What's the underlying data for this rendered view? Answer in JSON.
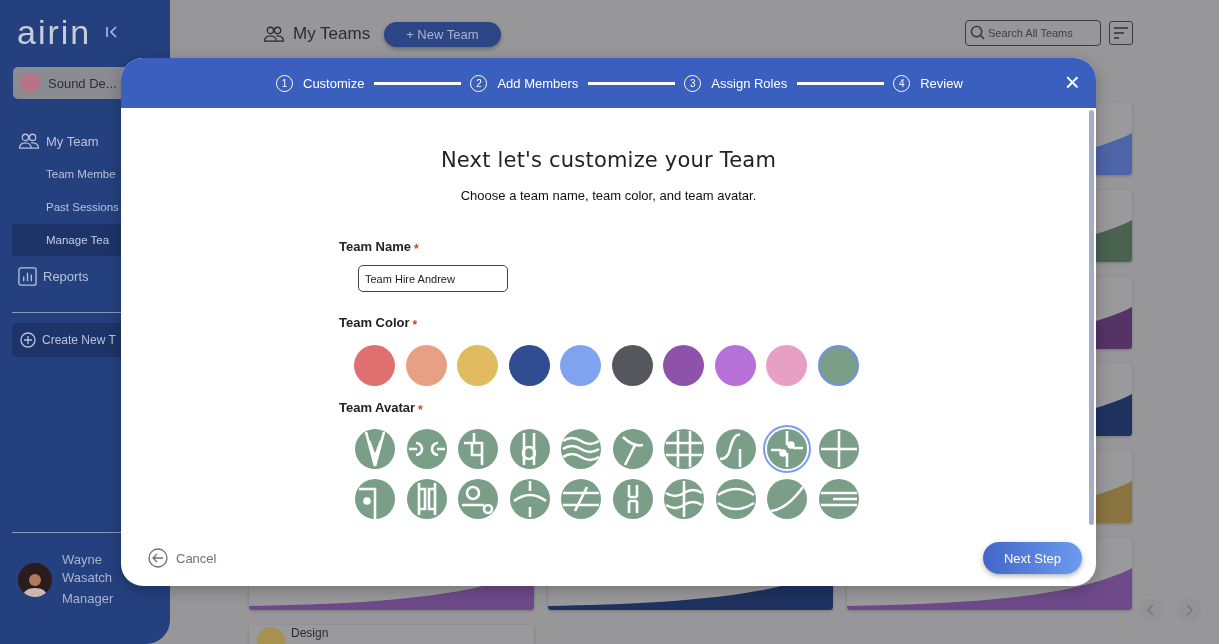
{
  "sidebar": {
    "logo": "airin",
    "team_switcher": "Sound De...",
    "nav": [
      {
        "label": "My Team",
        "kind": "section",
        "selected": false
      },
      {
        "label": "Team Membe",
        "kind": "sub",
        "selected": false
      },
      {
        "label": "Past Sessions",
        "kind": "sub",
        "selected": false
      },
      {
        "label": "Manage Tea",
        "kind": "sub",
        "selected": true
      },
      {
        "label": "Reports",
        "kind": "report",
        "selected": false
      }
    ],
    "create_button": "Create New T",
    "user": {
      "first_name": "Wayne",
      "last_name": "Wasatch",
      "role": "Manager"
    }
  },
  "header": {
    "title": "My Teams",
    "new_team_button": "+ New Team",
    "search": {
      "placeholder": "Search All Teams"
    }
  },
  "team_cards": [
    {
      "color": "#4d64a8"
    },
    {
      "color": "#4a6350"
    },
    {
      "color": "#553366"
    },
    {
      "color": "#1f3260"
    },
    {
      "color": "#8a7440"
    },
    {
      "color": "#6e4a8a"
    }
  ],
  "bottom_cards": [
    {
      "color": "#6e4a8a"
    },
    {
      "color": "#1f3260"
    }
  ],
  "design_card": {
    "name": "Design"
  },
  "modal": {
    "steps": [
      {
        "number": "1",
        "label": "Customize"
      },
      {
        "number": "2",
        "label": "Add Members"
      },
      {
        "number": "3",
        "label": "Assign Roles"
      },
      {
        "number": "4",
        "label": "Review"
      }
    ],
    "close": "×",
    "title": "Next let's customize your Team",
    "subtitle": "Choose a team name, team color, and team avatar.",
    "team_name": {
      "label": "Team Name",
      "required_mark": "*",
      "value": "Team Hire Andrew"
    },
    "team_color": {
      "label": "Team Color",
      "required_mark": "*",
      "options": [
        {
          "color": "#e07070",
          "selected": false
        },
        {
          "color": "#e8a084",
          "selected": false
        },
        {
          "color": "#e0bb60",
          "selected": false
        },
        {
          "color": "#2f4d90",
          "selected": false
        },
        {
          "color": "#7fa3ef",
          "selected": false
        },
        {
          "color": "#55575c",
          "selected": false
        },
        {
          "color": "#8f52aa",
          "selected": false
        },
        {
          "color": "#b870d9",
          "selected": false
        },
        {
          "color": "#e7a0c4",
          "selected": false
        },
        {
          "color": "#7a9e88",
          "selected": true
        }
      ]
    },
    "team_avatar": {
      "label": "Team Avatar",
      "required_mark": "*",
      "options": [
        {
          "selected": false
        },
        {
          "selected": false
        },
        {
          "selected": false
        },
        {
          "selected": false
        },
        {
          "selected": false
        },
        {
          "selected": false
        },
        {
          "selected": false
        },
        {
          "selected": false
        },
        {
          "selected": true
        },
        {
          "selected": false
        },
        {
          "selected": false
        },
        {
          "selected": false
        },
        {
          "selected": false
        },
        {
          "selected": false
        },
        {
          "selected": false
        },
        {
          "selected": false
        },
        {
          "selected": false
        },
        {
          "selected": false
        },
        {
          "selected": false
        },
        {
          "selected": false
        }
      ]
    },
    "cancel": "Cancel",
    "next": "Next Step"
  }
}
